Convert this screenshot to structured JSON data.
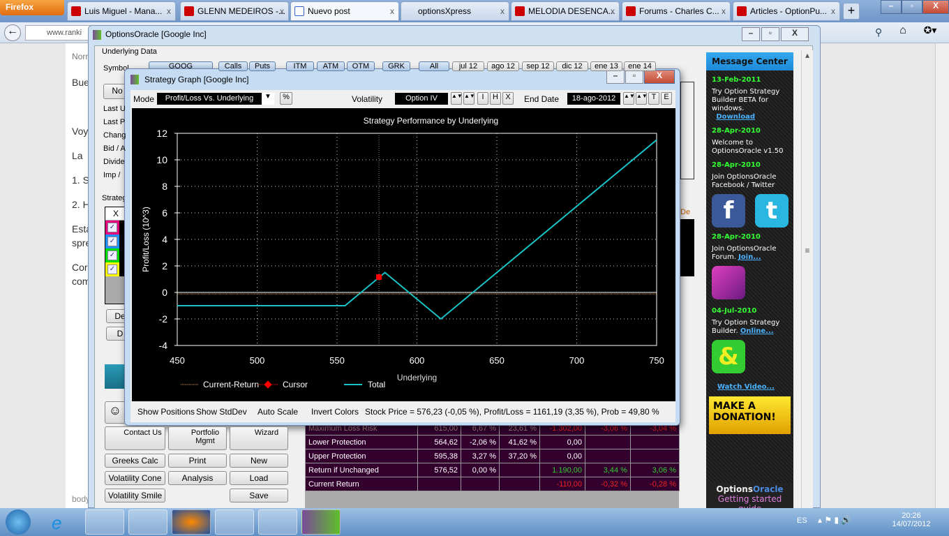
{
  "browser": {
    "menu_button": "Firefox",
    "tabs": [
      {
        "label": "Luis Miguel - Mana..."
      },
      {
        "label": "GLENN MEDEIROS -..."
      },
      {
        "label": "Nuevo post"
      },
      {
        "label": "optionsXpress"
      },
      {
        "label": "MELODIA DESENCA..."
      },
      {
        "label": "Forums - Charles C..."
      },
      {
        "label": "Articles - OptionPu..."
      }
    ],
    "new_tab": "+",
    "url": "www.ranki"
  },
  "page_fragments": [
    "Norr",
    "Bue",
    "Voy",
    "La",
    "1. S",
    "2. H",
    "Esta",
    "spre",
    "Cor",
    "com",
    "body"
  ],
  "oo": {
    "title": "OptionsOracle [Google Inc]",
    "underlying_label": "Underlying Data",
    "symbol_label": "Symbol",
    "symbol": "GOOG",
    "filter_buttons": [
      "Calls",
      "Puts",
      "ITM",
      "ATM",
      "OTM",
      "GRK",
      "All",
      "jul 12",
      "ago 12",
      "sep 12",
      "dic 12",
      "ene 13",
      "ene 14"
    ],
    "no_button": "No",
    "field_labels": [
      "Last U",
      "Last P",
      "Chang",
      "Bid / A",
      "Divide",
      "Imp /"
    ],
    "strategy_label": "Strateg",
    "strategy_col": "X",
    "strategy_colors": [
      "#e6007e",
      "#1e90ff",
      "#00e000",
      "#ffff00"
    ],
    "de_col": "De",
    "side_buttons": [
      "De",
      "D"
    ],
    "tool_buttons": [
      {
        "label": "Contact Us"
      },
      {
        "label": "Portfolio Mgmt"
      },
      {
        "label": "Wizard"
      },
      {
        "label": "Greeks Calc"
      },
      {
        "label": "Print"
      },
      {
        "label": "New"
      },
      {
        "label": "Volatility Cone"
      },
      {
        "label": "Analysis"
      },
      {
        "label": "Load"
      },
      {
        "label": "Volatility Smile"
      },
      {
        "label": "Save"
      }
    ],
    "results": [
      {
        "label": "Maximum Loss Risk",
        "c": [
          "615,00",
          "6,67 %",
          "23,61 %",
          "-1.302,00",
          "-3,06 %",
          "-3,04 %"
        ]
      },
      {
        "label": "Lower Protection",
        "c": [
          "564,62",
          "-2,06 %",
          "41,62 %",
          "0,00",
          "",
          ""
        ]
      },
      {
        "label": "Upper Protection",
        "c": [
          "595,38",
          "3,27 %",
          "37,20 %",
          "0,00",
          "",
          ""
        ]
      },
      {
        "label": "Return if Unchanged",
        "c": [
          "576,52",
          "0,00 %",
          "",
          "1.190,00",
          "3,44 %",
          "3,06 %"
        ]
      },
      {
        "label": "Current Return",
        "c": [
          "",
          "",
          "",
          "-110,00",
          "-0,32 %",
          "-0,28 %"
        ]
      }
    ]
  },
  "message_center": {
    "title": "Message Center",
    "items": [
      {
        "date": "13-Feb-2011",
        "text": "Try Option Strategy Builder BETA for windows.",
        "link": "Download"
      },
      {
        "date": "28-Apr-2010",
        "text": "Welcome to OptionsOracle v1.50",
        "link": ""
      },
      {
        "date": "28-Apr-2010",
        "text": "Join OptionsOracle Facebook / Twitter",
        "link": ""
      },
      {
        "date": "28-Apr-2010",
        "text": "Join OptionsOracle Forum.",
        "link": "Join..."
      },
      {
        "date": "04-Jul-2010",
        "text": "Try Option Strategy Builder.",
        "link": "Online..."
      }
    ],
    "watch": "Watch Video...",
    "donate": "MAKE A DONATION!",
    "brand_a": "Options",
    "brand_b": "Oracle",
    "guide": "Getting started guide"
  },
  "graph": {
    "title": "Strategy Graph [Google Inc]",
    "mode_label": "Mode",
    "mode": "Profit/Loss Vs. Underlying",
    "pct": "%",
    "vol_label": "Volatility",
    "vol": "Option IV",
    "btn_i": "I",
    "btn_h": "H",
    "btn_x": "X",
    "end_label": "End Date",
    "end_date": "18-ago-2012",
    "btn_t": "T",
    "btn_e": "E",
    "status": {
      "show_positions": "Show Positions",
      "show_stddev": "Show StdDev",
      "auto_scale": "Auto Scale",
      "invert": "Invert Colors",
      "info": "Stock Price = 576,23 (-0,05 %), Profit/Loss = 1161,19 (3,35 %), Prob = 49,80 %"
    }
  },
  "chart_data": {
    "type": "line",
    "title": "Strategy Performance by Underlying",
    "xlabel": "Underlying",
    "ylabel": "Profit/Loss (10^3)",
    "xlim": [
      450,
      750
    ],
    "ylim": [
      -4,
      12
    ],
    "xticks": [
      450,
      500,
      550,
      600,
      650,
      700,
      750
    ],
    "yticks": [
      -4,
      -2,
      0,
      2,
      4,
      6,
      8,
      10,
      12
    ],
    "grid": true,
    "legend": [
      "Current-Return",
      "Cursor",
      "Total"
    ],
    "series": [
      {
        "name": "Total",
        "color": "#19c3c8",
        "x": [
          450,
          555,
          580,
          615,
          750
        ],
        "y": [
          -1,
          -1,
          1.5,
          -2,
          11.5
        ]
      },
      {
        "name": "Current-Return",
        "color": "#e8a040",
        "x": [
          450,
          750
        ],
        "y": [
          -0.11,
          -0.11
        ]
      }
    ],
    "cursor": {
      "x": 576.23,
      "y": 1.16
    }
  },
  "taskbar": {
    "lang": "ES",
    "time": "20:26",
    "date": "14/07/2012"
  }
}
